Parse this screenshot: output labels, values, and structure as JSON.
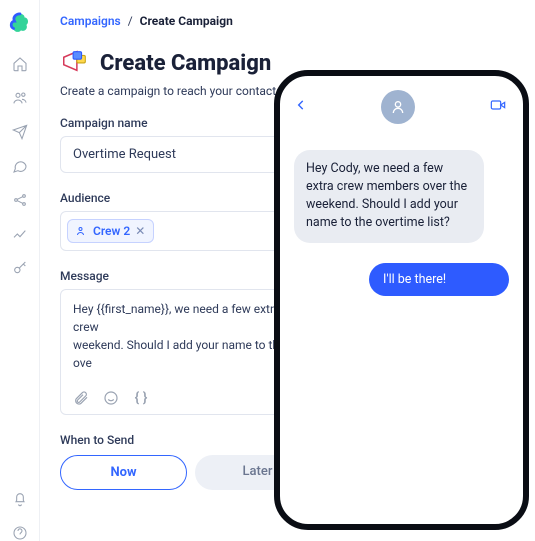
{
  "breadcrumb": {
    "root": "Campaigns",
    "sep": "/",
    "current": "Create Campaign"
  },
  "header": {
    "title": "Create Campaign",
    "subtitle": "Create a campaign to reach your contacts a"
  },
  "fields": {
    "name_label": "Campaign name",
    "name_value": "Overtime Request",
    "audience_label": "Audience",
    "audience_chip": "Crew 2",
    "message_label": "Message",
    "message_value": "Hey {{first_name}}, we need a few extra crew\nweekend. Should I add your name to the ove",
    "when_label": "When to Send",
    "now": "Now",
    "later": "Later"
  },
  "chat": {
    "incoming": "Hey Cody, we need a few extra crew members over the weekend. Should I add your name to the overtime list?",
    "outgoing": "I'll be there!"
  }
}
